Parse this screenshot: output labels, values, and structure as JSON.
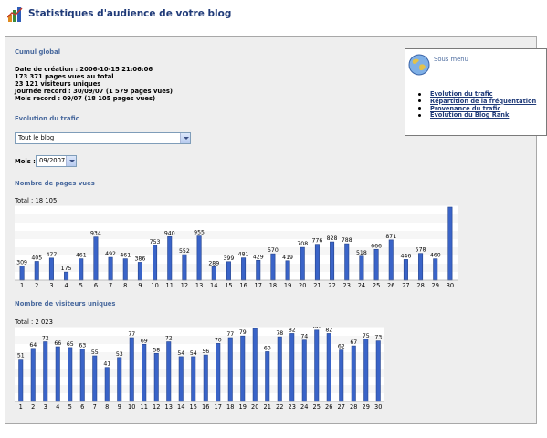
{
  "page": {
    "title": "Statistiques d'audience de votre blog"
  },
  "cumul": {
    "heading": "Cumul global",
    "lines": [
      "Date de création : 2006-10-15 21:06:06",
      "173 371 pages vues au total",
      "23 121 visiteurs uniques",
      "Journée record : 30/09/07 (1 579 pages vues)",
      "Mois record : 09/07 (18 105 pages vues)"
    ]
  },
  "sidebar": {
    "title": "Sous menu",
    "items": [
      {
        "label": "Evolution du trafic"
      },
      {
        "label": "Répartition de la fréquentation"
      },
      {
        "label": "Provenance du trafic"
      },
      {
        "label": "Evolution du Blog Rank"
      }
    ]
  },
  "traffic": {
    "heading": "Evolution du trafic",
    "scope_value": "Tout le blog",
    "month_label": "Mois :",
    "month_value": "09/2007"
  },
  "pages_chart": {
    "heading": "Nombre de pages vues",
    "total": "Total : 18 105"
  },
  "visitors_chart": {
    "heading": "Nombre de visiteurs uniques",
    "total": "Total : 2 023"
  },
  "colors": {
    "title": "#1f3a78",
    "section": "#4a6a9e",
    "bar": "#3a64c8"
  },
  "chart_data": [
    {
      "type": "bar",
      "title": "Nombre de pages vues",
      "categories": [
        "1",
        "2",
        "3",
        "4",
        "5",
        "6",
        "7",
        "8",
        "9",
        "10",
        "11",
        "12",
        "13",
        "14",
        "15",
        "16",
        "17",
        "18",
        "19",
        "20",
        "21",
        "22",
        "23",
        "24",
        "25",
        "26",
        "27",
        "28",
        "29",
        "30"
      ],
      "values": [
        309,
        405,
        477,
        175,
        461,
        934,
        492,
        461,
        386,
        753,
        940,
        552,
        955,
        289,
        399,
        481,
        429,
        570,
        419,
        708,
        776,
        828,
        788,
        518,
        666,
        871,
        446,
        578,
        460,
        1579
      ],
      "ylim": [
        0,
        1579
      ]
    },
    {
      "type": "bar",
      "title": "Nombre de visiteurs uniques",
      "categories": [
        "1",
        "2",
        "3",
        "4",
        "5",
        "6",
        "7",
        "8",
        "9",
        "10",
        "11",
        "12",
        "13",
        "14",
        "15",
        "16",
        "17",
        "18",
        "19",
        "20",
        "21",
        "22",
        "23",
        "24",
        "25",
        "26",
        "27",
        "28",
        "29",
        "30"
      ],
      "values": [
        51,
        64,
        72,
        66,
        65,
        63,
        55,
        41,
        53,
        77,
        69,
        58,
        72,
        54,
        54,
        56,
        70,
        77,
        79,
        88,
        60,
        78,
        82,
        74,
        86,
        82,
        62,
        67,
        75,
        73
      ],
      "ylim": [
        0,
        88
      ]
    }
  ]
}
